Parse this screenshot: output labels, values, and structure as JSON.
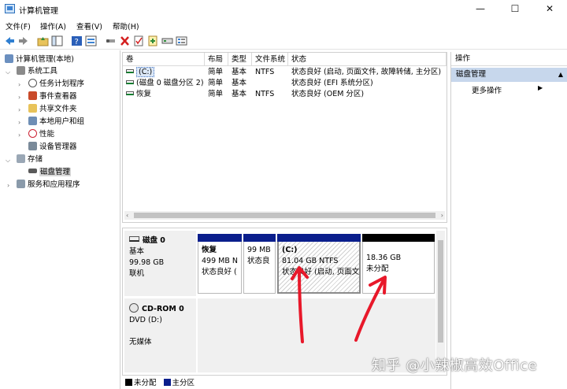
{
  "window": {
    "title": "计算机管理",
    "min": "—",
    "max": "☐",
    "close": "✕"
  },
  "menu": [
    "文件(F)",
    "操作(A)",
    "查看(V)",
    "帮助(H)"
  ],
  "tree": {
    "root": "计算机管理(本地)",
    "system_tools": "系统工具",
    "task_scheduler": "任务计划程序",
    "event_viewer": "事件查看器",
    "shared_folders": "共享文件夹",
    "local_users": "本地用户和组",
    "performance": "性能",
    "device_manager": "设备管理器",
    "storage": "存储",
    "disk_management": "磁盘管理",
    "services_apps": "服务和应用程序"
  },
  "volume_list": {
    "headers": [
      "卷",
      "布局",
      "类型",
      "文件系统",
      "状态"
    ],
    "rows": [
      {
        "volume": "(C:)",
        "layout": "简单",
        "type": "基本",
        "fs": "NTFS",
        "status": "状态良好 (启动, 页面文件, 故障转储, 主分区)"
      },
      {
        "volume": "(磁盘 0 磁盘分区 2)",
        "layout": "简单",
        "type": "基本",
        "fs": "",
        "status": "状态良好 (EFI 系统分区)"
      },
      {
        "volume": "恢复",
        "layout": "简单",
        "type": "基本",
        "fs": "NTFS",
        "status": "状态良好 (OEM 分区)"
      }
    ]
  },
  "disk0": {
    "name": "磁盘 0",
    "type": "基本",
    "size": "99.98 GB",
    "state": "联机",
    "partitions": [
      {
        "name": "恢复",
        "size": "499 MB N",
        "status": "状态良好 (",
        "color": "#0a1e8c"
      },
      {
        "name": "",
        "size": "99 MB",
        "status": "状态良",
        "color": "#0a1e8c"
      },
      {
        "name": "(C:)",
        "size": "81.04 GB NTFS",
        "status": "状态良好 (启动, 页面文",
        "color": "#0a1e8c"
      },
      {
        "name": "",
        "size": "18.36 GB",
        "status": "未分配",
        "color": "#000000"
      }
    ]
  },
  "cdrom": {
    "name": "CD-ROM 0",
    "drive": "DVD (D:)",
    "media": "无媒体"
  },
  "legend": {
    "unallocated": "未分配",
    "primary": "主分区",
    "unallocated_color": "#000000",
    "primary_color": "#0a1e8c"
  },
  "actions": {
    "header": "操作",
    "section": "磁盘管理",
    "more": "更多操作"
  },
  "watermark": "知乎 @小辣椒高效Office",
  "annotation_color": "#e8182a"
}
